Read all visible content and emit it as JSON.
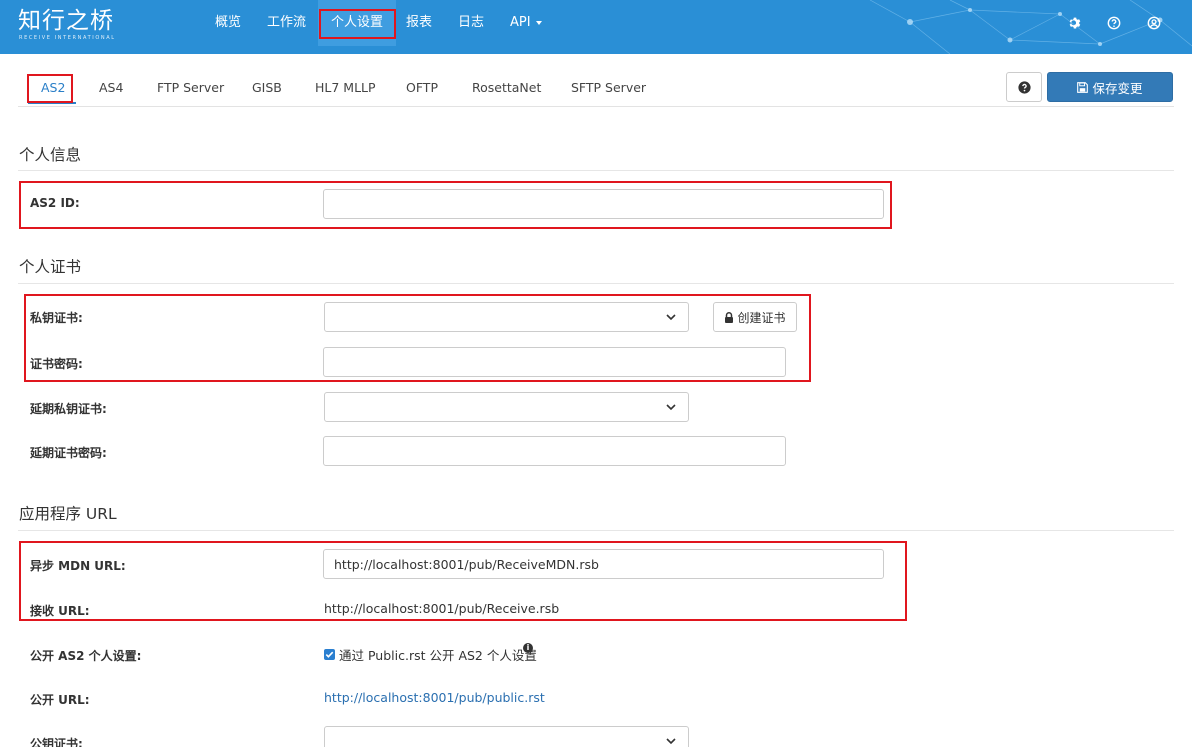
{
  "brand": {
    "logo_text": "知行之桥",
    "logo_subtext": "RECEIVE INTERNATIONAL"
  },
  "nav": {
    "items": [
      {
        "label": "概览"
      },
      {
        "label": "工作流"
      },
      {
        "label": "个人设置"
      },
      {
        "label": "报表"
      },
      {
        "label": "日志"
      },
      {
        "label": "API"
      }
    ],
    "active": "个人设置",
    "icons": [
      "gear-icon",
      "question-circle-icon",
      "user-circle-icon"
    ]
  },
  "tabs": {
    "items": [
      {
        "label": "AS2"
      },
      {
        "label": "AS4"
      },
      {
        "label": "FTP Server"
      },
      {
        "label": "GISB"
      },
      {
        "label": "HL7 MLLP"
      },
      {
        "label": "OFTP"
      },
      {
        "label": "RosettaNet"
      },
      {
        "label": "SFTP Server"
      }
    ],
    "active": "AS2"
  },
  "toolbar": {
    "help_icon": "?",
    "save_label": "保存变更",
    "save_icon": "floppy-disk-icon"
  },
  "personal_info": {
    "title": "个人信息",
    "as2_id_label": "AS2 ID:",
    "as2_id_value": ""
  },
  "personal_cert": {
    "title": "个人证书",
    "private_cert_label": "私钥证书:",
    "create_cert_label": "创建证书",
    "cert_password_label": "证书密码:",
    "deferred_private_cert_label": "延期私钥证书:",
    "deferred_cert_password_label": "延期证书密码:"
  },
  "app_url": {
    "title": "应用程序 URL",
    "async_mdn_label": "异步 MDN URL:",
    "async_mdn_value": "http://localhost:8001/pub/ReceiveMDN.rsb",
    "receive_url_label": "接收 URL:",
    "receive_url_value": "http://localhost:8001/pub/Receive.rsb",
    "public_profile_label": "公开 AS2 个人设置:",
    "public_profile_checkbox_text": "通过 Public.rst 公开 AS2 个人设置",
    "public_profile_checked": true,
    "public_url_label": "公开 URL:",
    "public_url_value": "http://localhost:8001/pub/public.rst",
    "public_cert_label": "公钥证书:"
  },
  "colors": {
    "navbar": "#2a8fd6",
    "highlight": "#e0161e",
    "primary": "#337ab7",
    "link": "#2a6fb0"
  }
}
